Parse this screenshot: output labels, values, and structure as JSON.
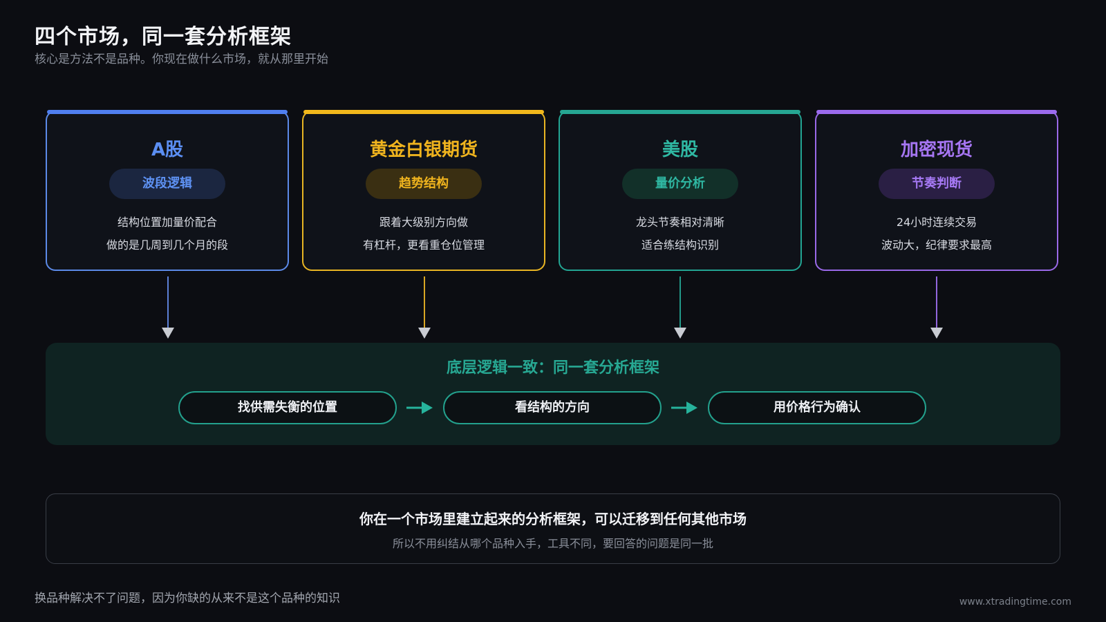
{
  "title": "四个市场，同一套分析框架",
  "subtitle": "核心是方法不是品种。你现在做什么市场，就从那里开始",
  "markets": [
    {
      "name": "A股",
      "method": "波段逻辑",
      "lines": [
        "结构位置加量价配合",
        "做的是几周到几个月的段"
      ],
      "color": "#5b8ef2"
    },
    {
      "name": "黄金白银期货",
      "method": "趋势结构",
      "lines": [
        "跟着大级别方向做",
        "有杠杆，更看重仓位管理"
      ],
      "color": "#f0b41e"
    },
    {
      "name": "美股",
      "method": "量价分析",
      "lines": [
        "龙头节奏相对清晰",
        "适合练结构识别"
      ],
      "color": "#2fb7a2"
    },
    {
      "name": "加密现货",
      "method": "节奏判断",
      "lines": [
        "24小时连续交易",
        "波动大，纪律要求最高"
      ],
      "color": "#a676f3"
    }
  ],
  "framework": {
    "title": "底层逻辑一致：同一套分析框架",
    "steps": [
      "找供需失衡的位置",
      "看结构的方向",
      "用价格行为确认"
    ],
    "color": "#27a893"
  },
  "conclusion": {
    "main": "你在一个市场里建立起来的分析框架，可以迁移到任何其他市场",
    "sub": "所以不用纠结从哪个品种入手，工具不同，要回答的问题是同一批"
  },
  "footer_note": "换品种解决不了问题，因为你缺的从来不是这个品种的知识",
  "watermark": "www.xtradingtime.com"
}
